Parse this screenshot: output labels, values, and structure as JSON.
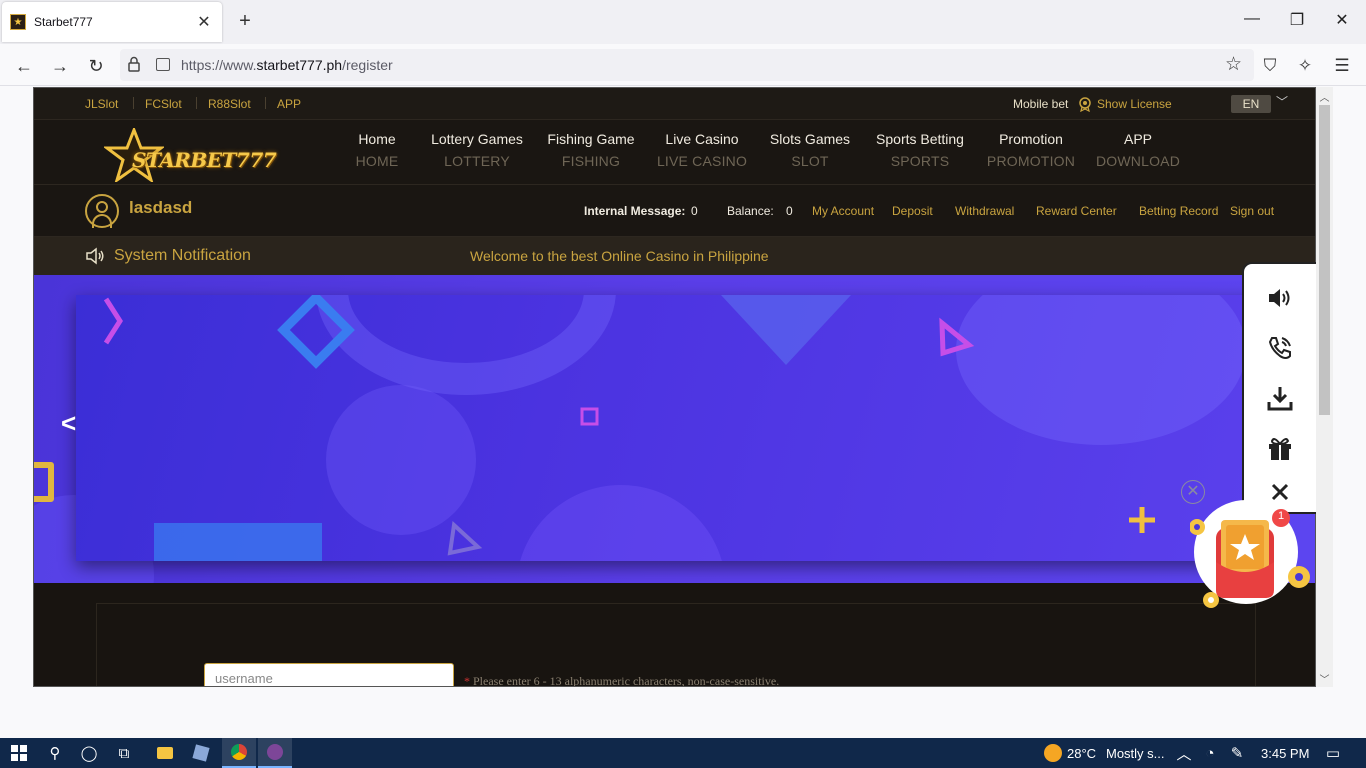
{
  "browser": {
    "tab_title": "Starbet777",
    "url_prefix": "https://www.",
    "url_domain": "starbet777.ph",
    "url_path": "/register"
  },
  "topline": {
    "links": [
      "JLSlot",
      "FCSlot",
      "R88Slot",
      "APP"
    ],
    "mobile_bet": "Mobile bet",
    "show_license": "Show License",
    "language": "EN"
  },
  "logo": {
    "text": "STARBET777"
  },
  "menu": [
    {
      "label": "Home",
      "sub": "HOME"
    },
    {
      "label": "Lottery Games",
      "sub": "LOTTERY"
    },
    {
      "label": "Fishing Game",
      "sub": "FISHING"
    },
    {
      "label": "Live Casino",
      "sub": "LIVE CASINO"
    },
    {
      "label": "Slots Games",
      "sub": "SLOT"
    },
    {
      "label": "Sports Betting",
      "sub": "SPORTS"
    },
    {
      "label": "Promotion",
      "sub": "PROMOTION"
    },
    {
      "label": "APP",
      "sub": "DOWNLOAD"
    }
  ],
  "user": {
    "name": "lasdasd",
    "internal_message_label": "Internal Message:",
    "internal_message_count": "0",
    "balance_label": "Balance:",
    "balance_value": "0",
    "links": [
      "My Account",
      "Deposit",
      "Withdrawal",
      "Reward Center",
      "Betting Record",
      "Sign out"
    ]
  },
  "notice": {
    "title": "System Notification",
    "message": "Welcome to the best Online Casino in Philippine"
  },
  "banner": {
    "prev": "<"
  },
  "form": {
    "username_placeholder": "username",
    "username_hint_req": "*",
    "username_hint": " Please enter 6 - 13 alphanumeric characters, non-case-sensitive."
  },
  "gift": {
    "badge_count": "1"
  },
  "taskbar": {
    "weather": "28°C",
    "weather_desc": "Mostly s...",
    "time": "3:45 PM"
  },
  "colors": {
    "gold": "#c9a440",
    "dark_bg": "#1a1612",
    "banner_purple": "#5040e0"
  }
}
